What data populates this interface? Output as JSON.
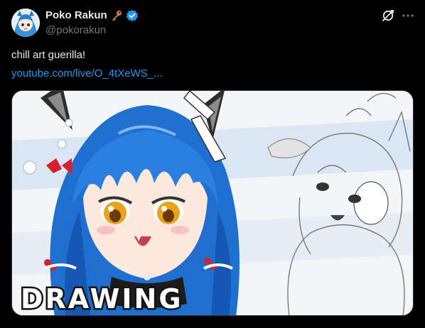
{
  "tweet": {
    "author": {
      "name": "Poko Rakun",
      "handle": "@pokorakun",
      "badges": [
        "key-icon",
        "verified-icon"
      ]
    },
    "text": "chill art guerilla!",
    "link": "youtube.com/live/O_4tXeWS_...",
    "actions": [
      "grok-icon",
      "more-icon"
    ],
    "media": {
      "overlay_text": "DRAWING"
    }
  },
  "colors": {
    "background": "#000000",
    "text_primary": "#e7e9ea",
    "text_secondary": "#71767b",
    "link": "#1d9bf0",
    "verified": "#1d9bf0",
    "key": "#c8775b"
  }
}
